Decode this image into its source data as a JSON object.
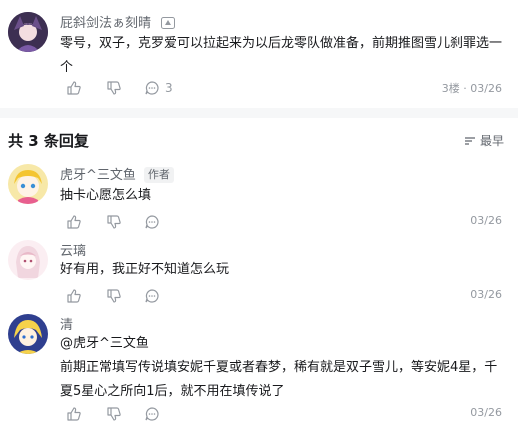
{
  "post": {
    "author": "屁斜剑法ぁ刻晴",
    "text": "零号，双子，克罗爱可以拉起来为以后龙零队做准备，前期推图雪儿刹罪选一个",
    "comment_count": "3",
    "floor": "3楼",
    "date": "03/26"
  },
  "replies_header": {
    "prefix": "共",
    "count": "3",
    "suffix": "条回复",
    "sort_label": "最早"
  },
  "replies": [
    {
      "author": "虎牙^三文鱼",
      "badge": "作者",
      "text": "抽卡心愿怎么填",
      "date": "03/26"
    },
    {
      "author": "云璃",
      "text": "好有用，我正好不知道怎么玩",
      "date": "03/26"
    },
    {
      "author": "清",
      "mention": "@虎牙^三文鱼",
      "text": "前期正常填写传说填安妮千夏或者春梦，稀有就是双子雪儿，等安妮4星，千夏5星心之所向1后，就不用在填传说了",
      "date": "03/26"
    }
  ],
  "colors": {
    "accent": "#00aeec",
    "muted": "#9499a0"
  },
  "icons": [
    "like-icon",
    "dislike-icon",
    "comment-icon",
    "sort-icon",
    "level-badge-icon"
  ]
}
